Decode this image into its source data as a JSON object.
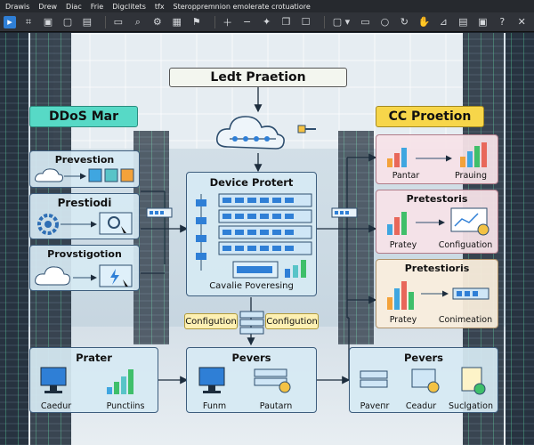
{
  "menu": [
    "Drawis",
    "Drew",
    "Diac",
    "Frie",
    "Digclitets",
    "tfx",
    "Steroppremnion emolerate crotuatiore"
  ],
  "colors": {
    "accent": "#2f7fd6",
    "banner_green": "#57d9c6",
    "banner_yellow": "#f7d64a",
    "config_tag": "#fdf0b3"
  },
  "diagram": {
    "top_title": "Ledt Praetion",
    "left_banner": "DDoS Mar",
    "right_banner": "CC Proetion",
    "left_boxes": [
      {
        "title": "Prevestion"
      },
      {
        "title": "Prestiodi"
      },
      {
        "title": "Provstigotion"
      }
    ],
    "center": {
      "title": "Device Protert",
      "caption": "Cavalie Poveresing"
    },
    "right_boxes": [
      {
        "title": "",
        "label_left": "Pantar",
        "label_right": "Prauing"
      },
      {
        "title": "Pretestoris",
        "label_left": "Pratey",
        "label_right": "Configuation"
      },
      {
        "title": "Pretestioris",
        "label_left": "Pratey",
        "label_right": "Conimeation"
      }
    ],
    "config_left": "Configution",
    "config_right": "Configution",
    "bottom_boxes": [
      {
        "title": "Prater",
        "labels": [
          "Caedur",
          "Punctiins"
        ]
      },
      {
        "title": "Pevers",
        "labels": [
          "Funm",
          "Pautarn"
        ]
      },
      {
        "title": "Pevers",
        "labels": [
          "Paveпr",
          "Ceadur",
          "Suclgation"
        ]
      }
    ]
  }
}
